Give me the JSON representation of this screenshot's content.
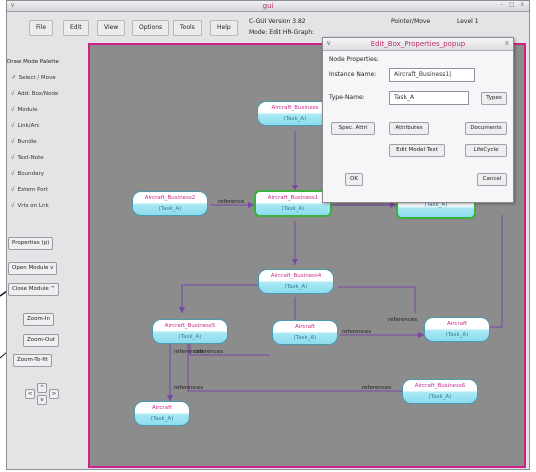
{
  "window": {
    "title": "gui",
    "left_glyph": "∨",
    "controls": "- □ x"
  },
  "menu": {
    "file": "File",
    "edit": "Edit",
    "view": "View",
    "options": "Options",
    "tools": "Tools",
    "help": "Help"
  },
  "status": {
    "version": "C-GUI Version 3.82",
    "mode": "Mode:  Edit HR-Graph:",
    "pointer": "Pointer/Move",
    "level": "Level 1"
  },
  "palette": {
    "title": "Draw Mode Palette",
    "items": [
      {
        "mark": "↗",
        "label": "Select / Move"
      },
      {
        "mark": "√",
        "label": "Add: Box/Node"
      },
      {
        "mark": "√",
        "label": "Module"
      },
      {
        "mark": "√",
        "label": "Link/Arc"
      },
      {
        "mark": "√",
        "label": "Bundle"
      },
      {
        "mark": "√",
        "label": "Text-Note"
      },
      {
        "mark": "√",
        "label": "Boundary"
      },
      {
        "mark": "√",
        "label": "Extern Port"
      },
      {
        "mark": "√",
        "label": "Vrts on Lnk"
      }
    ],
    "properties": "Properties (p)",
    "open_module": "Open Module  v",
    "close_module": "Close Module ^",
    "zoom_in": "Zoom-In",
    "zoom_out": "Zoom-Out",
    "zoom_fit": "Zoom-To-fit",
    "arrows": {
      "left": "<",
      "up": "^",
      "right": ">",
      "down": "v"
    }
  },
  "nodes": [
    {
      "name": "Aircraft_Business",
      "type": "(Task_A)"
    },
    {
      "name": "Aircraft_Business2",
      "type": "(Task_A)"
    },
    {
      "name": "Aircraft_Business1",
      "type": "(Task_A)"
    },
    {
      "name": "Aircraft_Business4",
      "type": "(Task_A)"
    },
    {
      "name": "Aircraft_Business5",
      "type": "(Task_A)"
    },
    {
      "name": "Aircraft",
      "type": "(Task_A)"
    },
    {
      "name": "Aircraft",
      "type": "(Task_A)"
    },
    {
      "name": "Aircraft_Business6",
      "type": "(Task_A)"
    },
    {
      "name": "Aircraft",
      "type": "(Task_A)"
    },
    {
      "name": "",
      "type": "(Task_A)"
    }
  ],
  "edge_labels": {
    "e1": "reference",
    "e2": "references",
    "e3": "references",
    "e4": "references",
    "e5": "references",
    "e6": "references",
    "e7": "references"
  },
  "popup": {
    "title": "Edit_Box_Properties_popup",
    "left_glyph": "∨",
    "close_glyph": "x",
    "section": "Node Properties:",
    "instance_label": "Instance Name:",
    "instance_value": "Aircraft_Business1|",
    "type_label": "Type-Name:",
    "type_value": "Task_A",
    "types_btn": "Types",
    "spec_btn": "Spec. Attri",
    "attributes_btn": "Attributes",
    "documents_btn": "Documents",
    "edit_model_btn": "Edit Model Text",
    "lifecycle_btn": "LifeCycle",
    "ok_btn": "OK",
    "cancel_btn": "Cancel"
  }
}
